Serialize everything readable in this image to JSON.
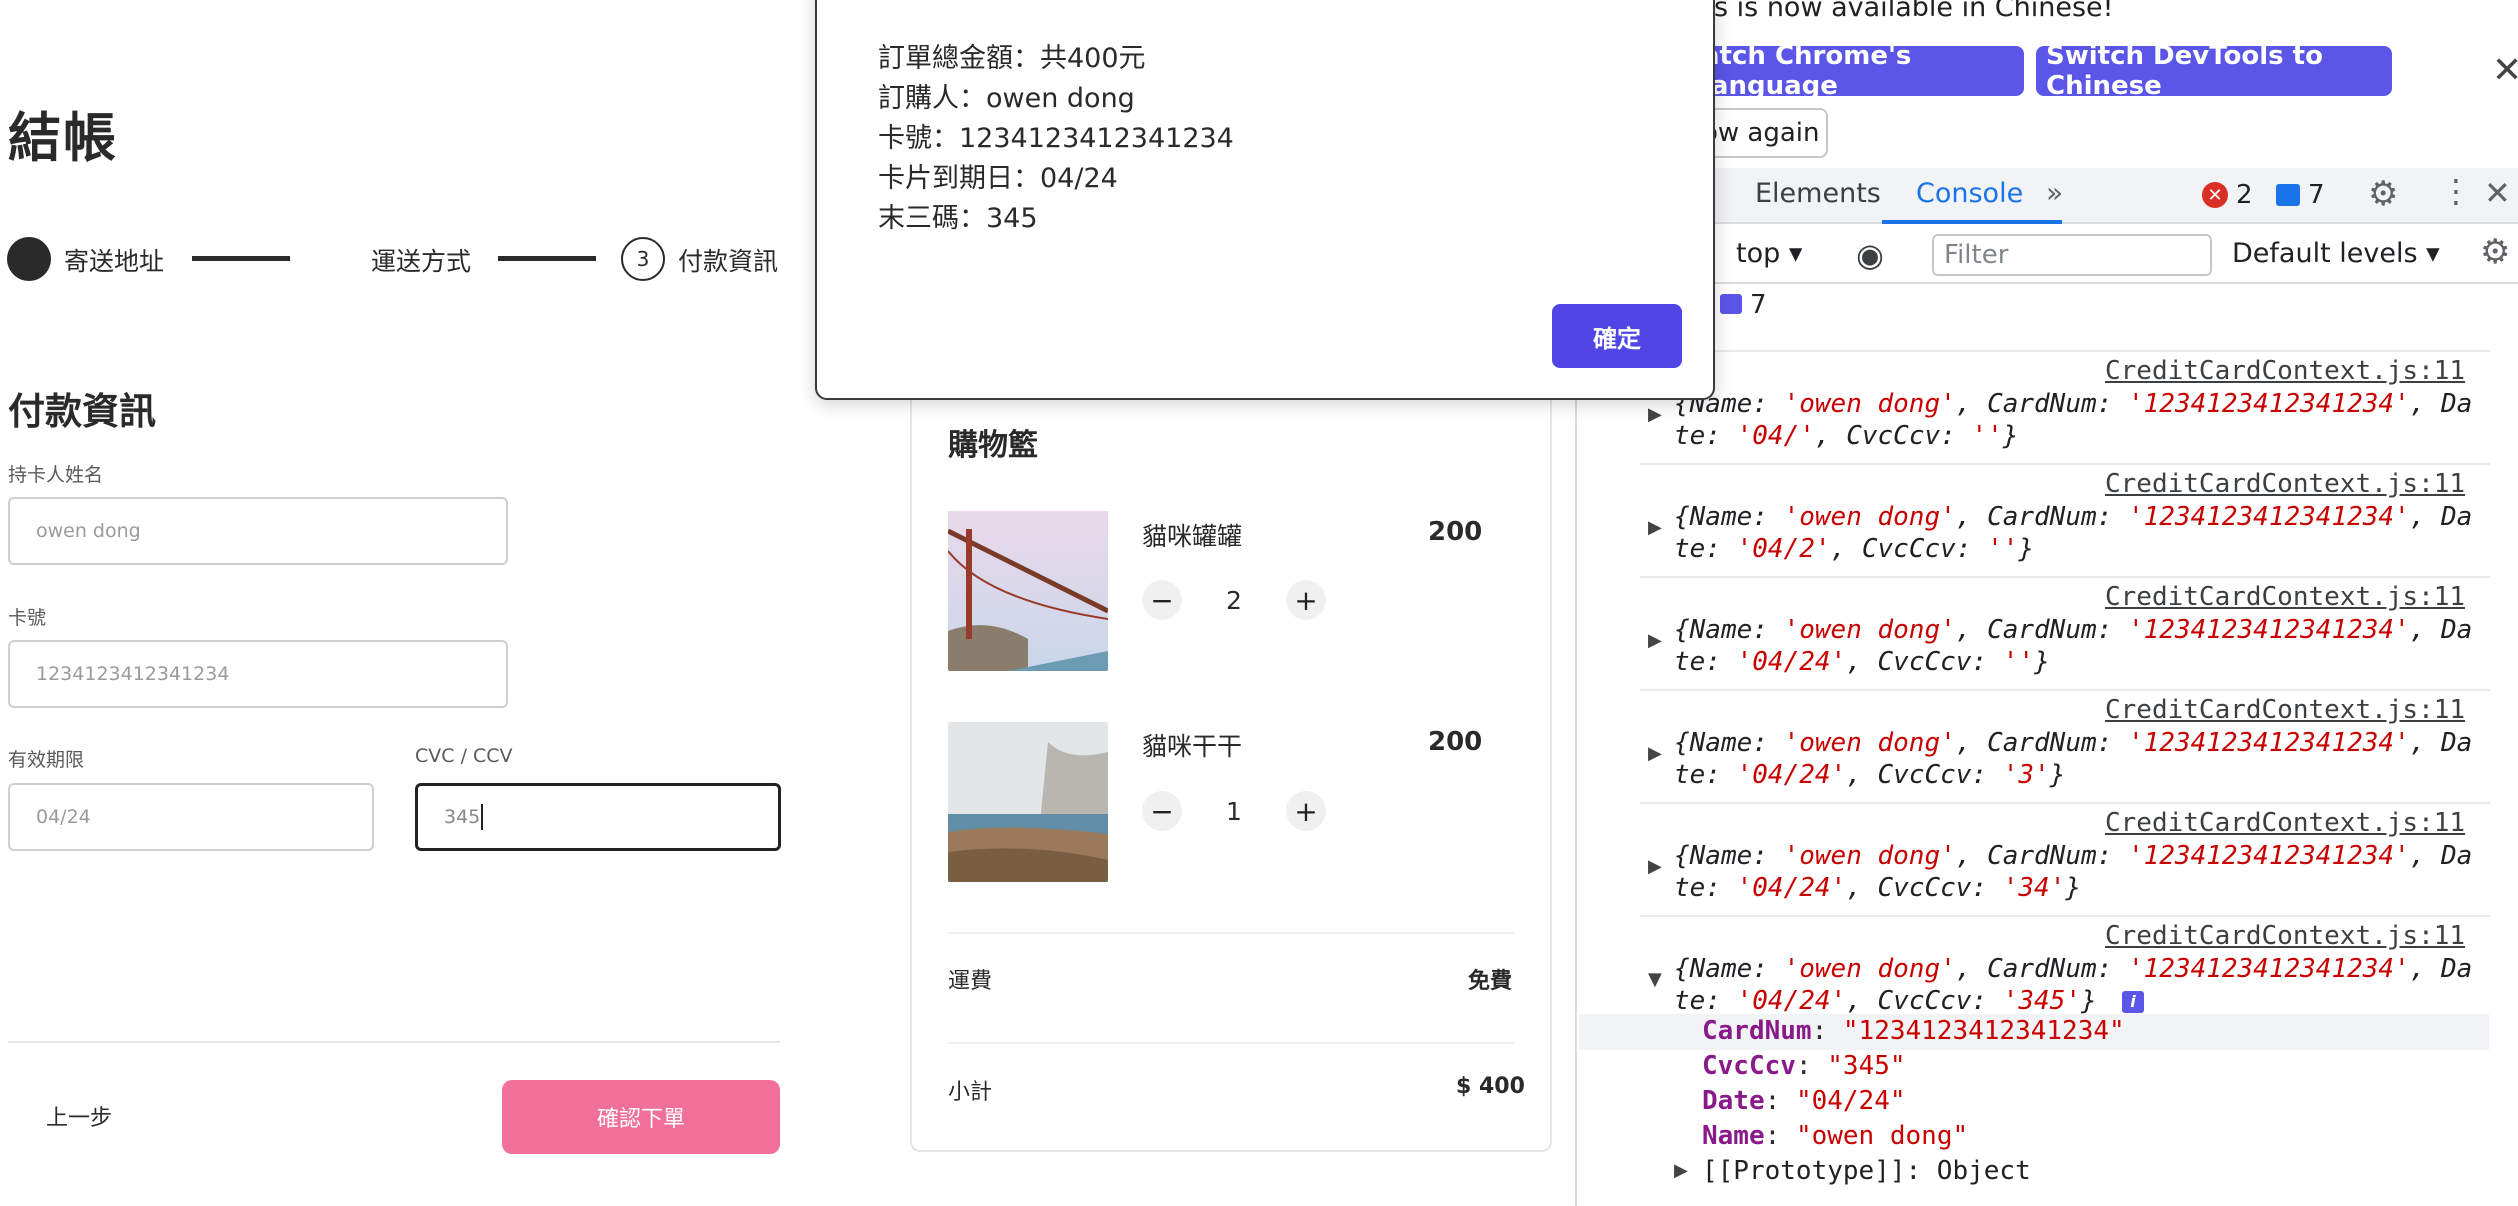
{
  "checkout": {
    "title": "結帳",
    "steps": [
      {
        "label": "寄送地址",
        "state": "done"
      },
      {
        "label": "運送方式",
        "state": "done"
      },
      {
        "number": "3",
        "label": "付款資訊",
        "state": "active"
      }
    ],
    "section_title": "付款資訊",
    "fields": {
      "holder_label": "持卡人姓名",
      "holder_value": "owen dong",
      "card_label": "卡號",
      "card_value": "1234123412341234",
      "expiry_label": "有效期限",
      "expiry_value": "04/24",
      "cvc_label": "CVC / CCV",
      "cvc_value": "345"
    },
    "prev_label": "上一步",
    "confirm_label": "確認下單",
    "confirm_color": "#f0709a"
  },
  "cart": {
    "title": "購物籃",
    "items": [
      {
        "name": "貓咪罐罐",
        "price": "200",
        "qty": "2"
      },
      {
        "name": "貓咪干干",
        "price": "200",
        "qty": "1"
      }
    ],
    "shipping_label": "運費",
    "shipping_value": "免費",
    "subtotal_label": "小計",
    "subtotal_value": "$ 400"
  },
  "dialog": {
    "lines": [
      "訂單總金額：共400元",
      "訂購人：owen dong",
      "卡號：1234123412341234",
      "卡片到期日：04/24",
      "末三碼：345"
    ],
    "ok_label": "確定",
    "ok_color": "#4f46e5"
  },
  "devtools": {
    "banner_text": "ols is now available in Chinese!",
    "match_lang_label": "atch Chrome's language",
    "switch_label": "Switch DevTools to Chinese",
    "dont_show_label": "ow again",
    "tabs": [
      "Elements",
      "Console"
    ],
    "active_tab": "Console",
    "error_count": "2",
    "message_count": "7",
    "context": "top",
    "filter_placeholder": "Filter",
    "levels": "Default levels",
    "sidebar_count": "7",
    "source": "CreditCardContext.js:11",
    "logs": [
      {
        "line1": "{Name: 'owen dong', CardNum: '1234123412341234', Da",
        "line2": "te: '04/', CvcCcv: ''}"
      },
      {
        "line1": "{Name: 'owen dong', CardNum: '1234123412341234', Da",
        "line2": "te: '04/2', CvcCcv: ''}"
      },
      {
        "line1": "{Name: 'owen dong', CardNum: '1234123412341234', Da",
        "line2": "te: '04/24', CvcCcv: ''}"
      },
      {
        "line1": "{Name: 'owen dong', CardNum: '1234123412341234', Da",
        "line2": "te: '04/24', CvcCcv: '3'}"
      },
      {
        "line1": "{Name: 'owen dong', CardNum: '1234123412341234', Da",
        "line2": "te: '04/24', CvcCcv: '34'}"
      },
      {
        "line1": "{Name: 'owen dong', CardNum: '1234123412341234', Da",
        "line2": "te: '04/24', CvcCcv: '345'}"
      }
    ],
    "expanded": {
      "props": [
        {
          "key": "CardNum",
          "value": "\"1234123412341234\""
        },
        {
          "key": "CvcCcv",
          "value": "\"345\""
        },
        {
          "key": "Date",
          "value": "\"04/24\""
        },
        {
          "key": "Name",
          "value": "\"owen dong\""
        }
      ],
      "prototype": "[[Prototype]]: Object"
    }
  }
}
